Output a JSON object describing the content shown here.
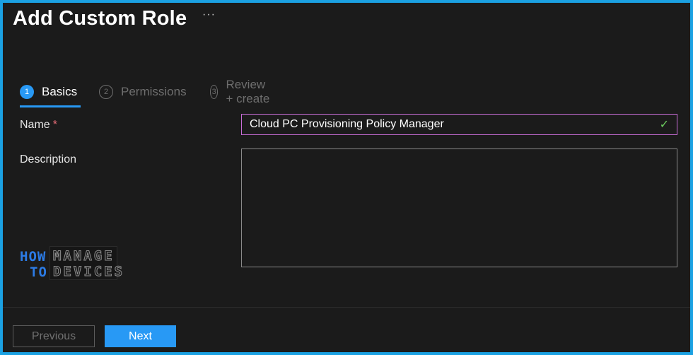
{
  "page": {
    "title": "Add Custom Role",
    "more_label": "···"
  },
  "tabs": [
    {
      "number": "1",
      "label": "Basics",
      "active": true
    },
    {
      "number": "2",
      "label": "Permissions",
      "active": false
    },
    {
      "number": "3",
      "label": "Review + create",
      "active": false
    }
  ],
  "form": {
    "name_label": "Name",
    "required_marker": "*",
    "name_value": "Cloud PC Provisioning Policy Manager",
    "valid_icon": "✓",
    "description_label": "Description",
    "description_value": ""
  },
  "logo": {
    "line1_left": "HOW",
    "line2_left": "TO",
    "line1_right": "MANAGE",
    "line2_right": "DEVICES"
  },
  "footer": {
    "previous_label": "Previous",
    "next_label": "Next"
  },
  "colors": {
    "accent": "#2899f5",
    "frame": "#1ba1e2",
    "background": "#1b1b1b",
    "focus_border": "#c86dd7",
    "valid": "#6ccb5f",
    "required": "#f1707b"
  }
}
